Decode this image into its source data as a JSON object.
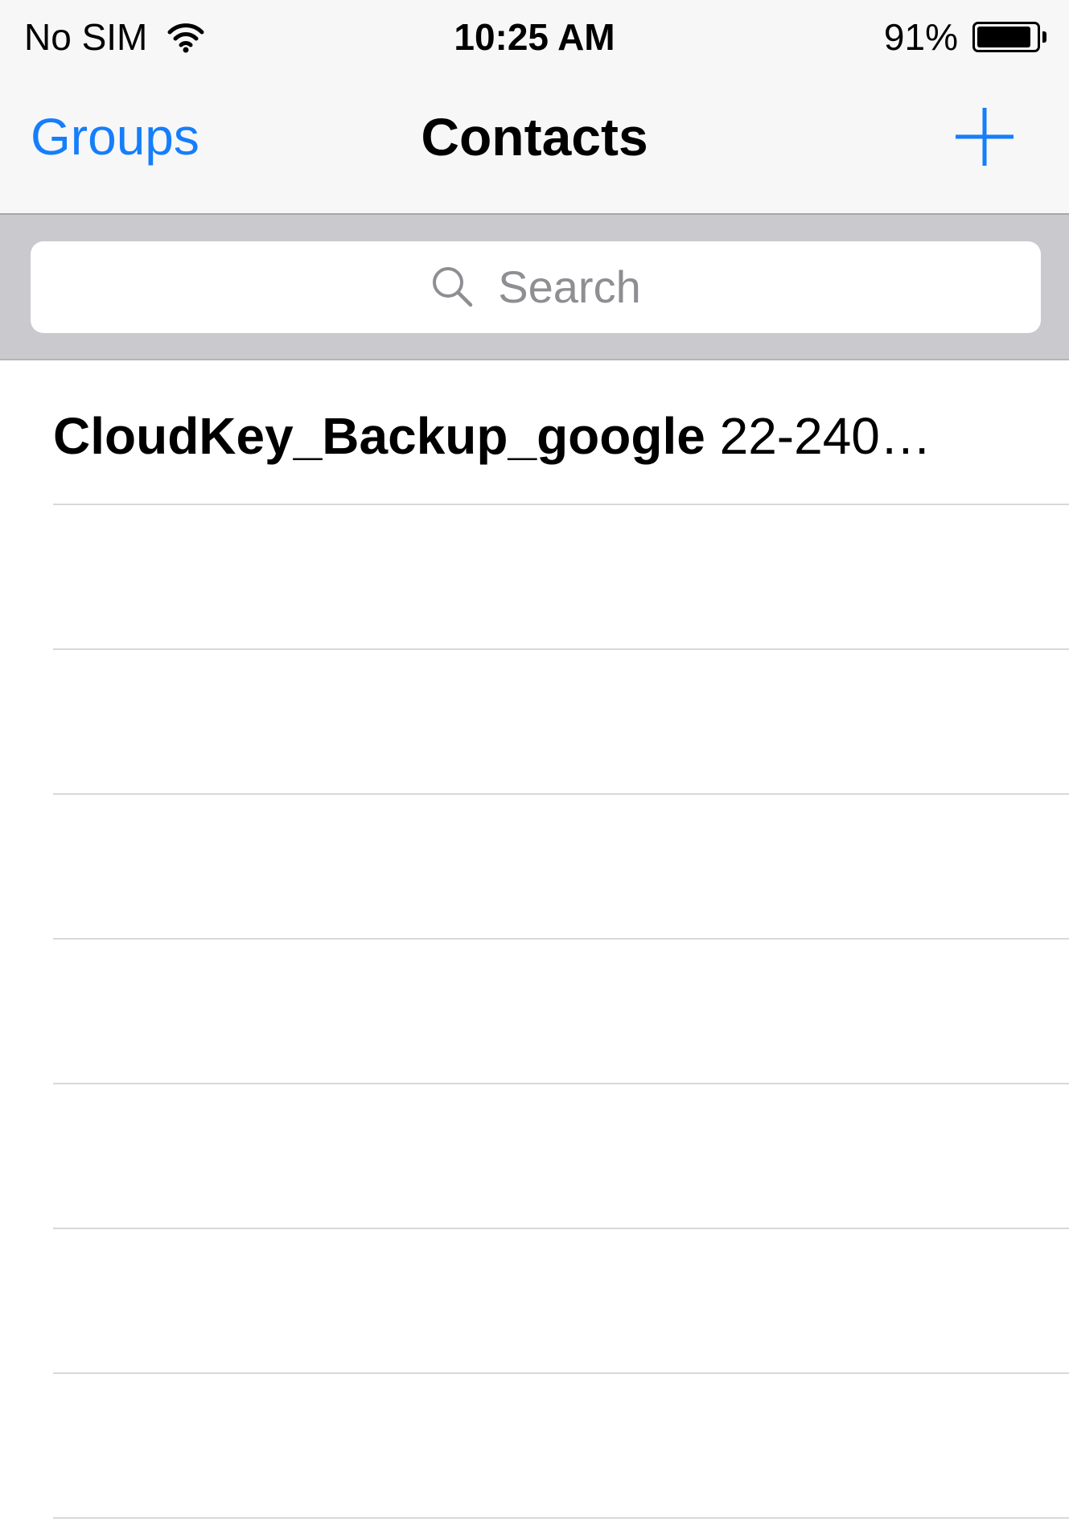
{
  "status_bar": {
    "carrier": "No SIM",
    "time": "10:25 AM",
    "battery_percent": "91%",
    "battery_level": 0.91,
    "wifi_icon": "wifi-icon"
  },
  "nav": {
    "left_label": "Groups",
    "title": "Contacts",
    "right_icon": "plus-icon",
    "accent_color": "#157efb"
  },
  "search": {
    "placeholder": "Search",
    "icon": "search-icon"
  },
  "contacts": [
    {
      "name": "CloudKey_Backup_google",
      "detail": "22-240…"
    }
  ],
  "colors": {
    "bar_background": "#f7f7f7",
    "search_background": "#c9c9ce",
    "separator": "#d8d8dc",
    "placeholder_text": "#8e8e93"
  }
}
